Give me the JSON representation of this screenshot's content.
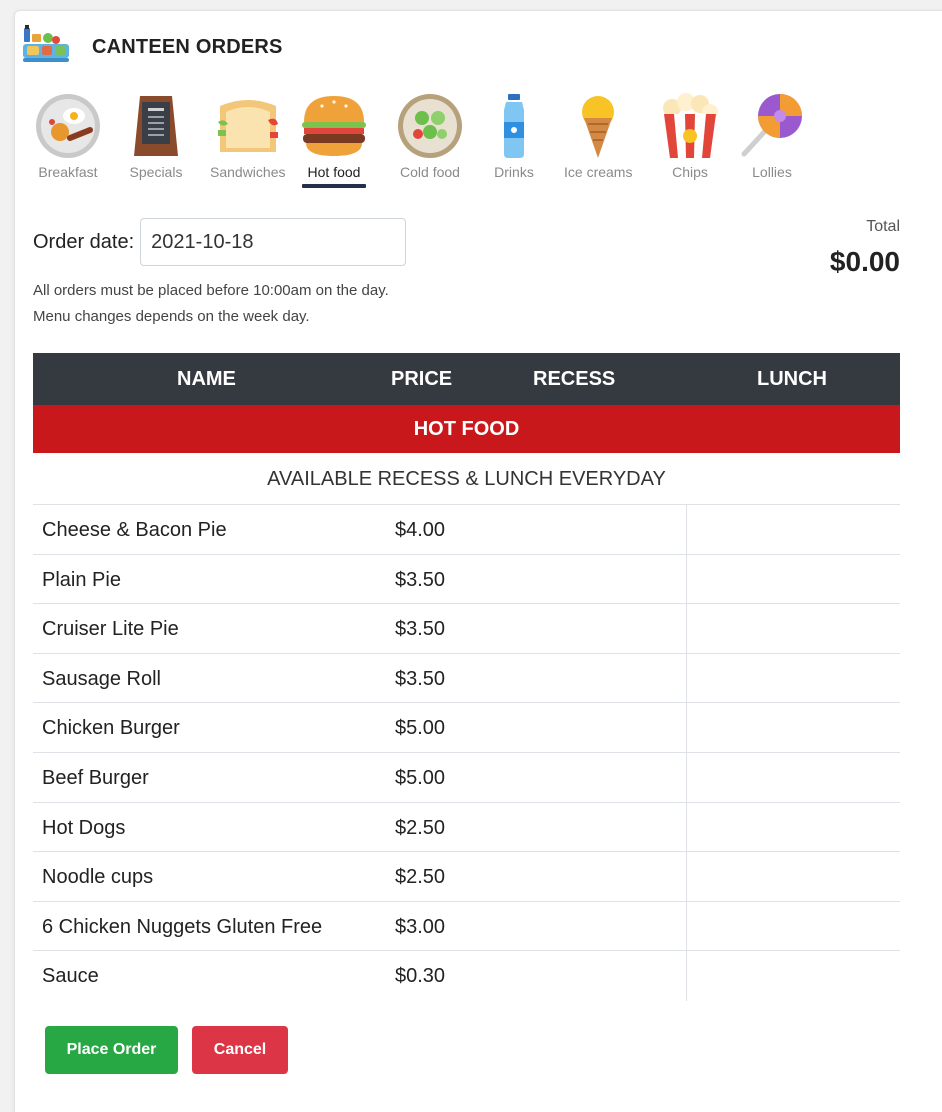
{
  "app": {
    "title": "CANTEEN ORDERS"
  },
  "categories": [
    {
      "label": "Breakfast",
      "icon": "breakfast-plate-icon"
    },
    {
      "label": "Specials",
      "icon": "menu-board-icon"
    },
    {
      "label": "Sandwiches",
      "icon": "sandwich-icon"
    },
    {
      "label": "Hot food",
      "icon": "burger-icon",
      "active": true
    },
    {
      "label": "Cold food",
      "icon": "salad-bowl-icon"
    },
    {
      "label": "Drinks",
      "icon": "water-bottle-icon"
    },
    {
      "label": "Ice creams",
      "icon": "ice-cream-cone-icon"
    },
    {
      "label": "Chips",
      "icon": "popcorn-icon"
    },
    {
      "label": "Lollies",
      "icon": "lollipop-icon"
    }
  ],
  "order": {
    "date_label": "Order date:",
    "date_value": "2021-10-18",
    "note1": "All orders must be placed before 10:00am on the day.",
    "note2": "Menu changes depends on the week day."
  },
  "total": {
    "label": "Total",
    "value": "$0.00"
  },
  "table": {
    "headers": {
      "name": "NAME",
      "price": "PRICE",
      "recess": "RECESS",
      "lunch": "LUNCH"
    },
    "section": "HOT FOOD",
    "subheading": "AVAILABLE RECESS & LUNCH EVERYDAY",
    "rows": [
      {
        "name": "Cheese & Bacon Pie",
        "price": "$4.00"
      },
      {
        "name": "Plain Pie",
        "price": "$3.50"
      },
      {
        "name": "Cruiser Lite Pie",
        "price": "$3.50"
      },
      {
        "name": "Sausage Roll",
        "price": "$3.50"
      },
      {
        "name": "Chicken Burger",
        "price": "$5.00"
      },
      {
        "name": "Beef Burger",
        "price": "$5.00"
      },
      {
        "name": "Hot Dogs",
        "price": "$2.50"
      },
      {
        "name": "Noodle cups",
        "price": "$2.50"
      },
      {
        "name": "6 Chicken Nuggets Gluten Free",
        "price": "$3.00"
      },
      {
        "name": "Sauce",
        "price": "$0.30"
      }
    ]
  },
  "buttons": {
    "place_order": "Place Order",
    "cancel": "Cancel"
  },
  "colors": {
    "header_dark": "#343a40",
    "section_red": "#c8181b",
    "place_green": "#28a745",
    "cancel_red": "#dc3545",
    "active_underline": "#22304a"
  }
}
